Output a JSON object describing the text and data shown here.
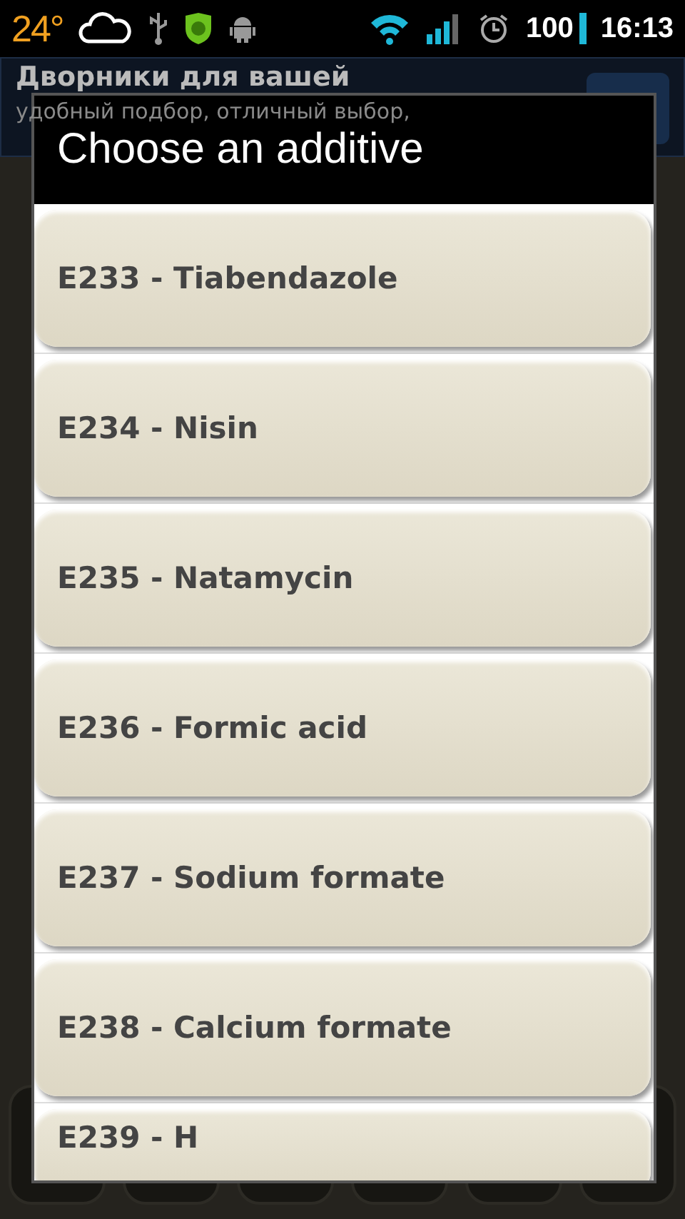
{
  "status_bar": {
    "temperature": "24°",
    "battery": "100",
    "time": "16:13"
  },
  "ad_banner": {
    "title": "Дворники для вашей",
    "text": "удобный подбор, отличный выбор,"
  },
  "dialog": {
    "title": "Choose an additive",
    "items": [
      {
        "label": "E233 - Tiabendazole"
      },
      {
        "label": "E234 - Nisin"
      },
      {
        "label": "E235 - Natamycin"
      },
      {
        "label": "E236 - Formic acid"
      },
      {
        "label": "E237 - Sodium formate"
      },
      {
        "label": "E238 - Calcium formate"
      },
      {
        "label": "E239 - H"
      }
    ]
  }
}
